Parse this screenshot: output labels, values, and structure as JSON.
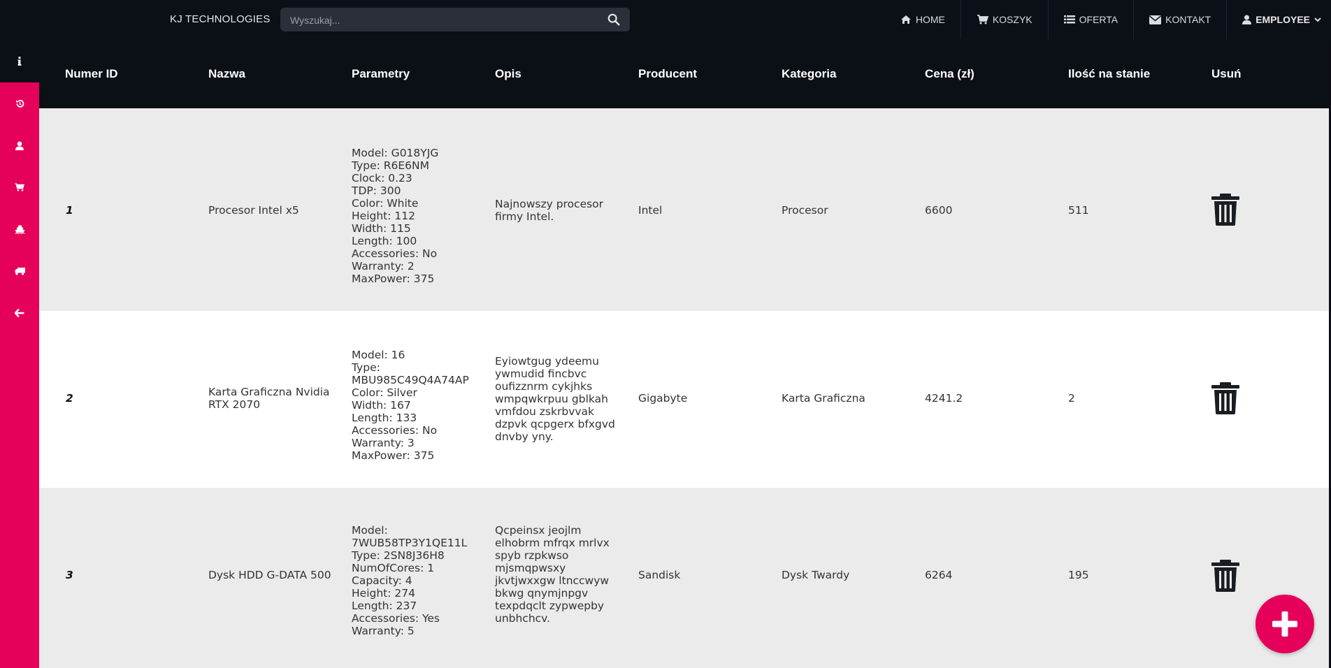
{
  "brand": "KJ TECHNOLOGIES",
  "search": {
    "placeholder": "Wyszukaj...",
    "value": ""
  },
  "nav": {
    "home": "HOME",
    "cart": "KOSZYK",
    "offer": "OFERTA",
    "contact": "KONTAKT",
    "user": "EMPLOYEE"
  },
  "sidebar": {
    "items": [
      "info-icon",
      "history-icon",
      "user-icon",
      "cart-icon",
      "ship-icon",
      "truck-icon",
      "back-arrow-icon"
    ]
  },
  "table": {
    "headers": [
      "Numer ID",
      "Nazwa",
      "Parametry",
      "Opis",
      "Producent",
      "Kategoria",
      "Cena (zł)",
      "Ilość na stanie",
      "Usuń"
    ],
    "rows": [
      {
        "id": "1",
        "name": [
          "Procesor Intel x5"
        ],
        "params": [
          "Model: G018YJG",
          "Type: R6E6NM",
          "Clock: 0.23",
          "TDP: 300",
          "Color: White",
          "Height: 112",
          "Width: 115",
          "Length: 100",
          "Accessories: No",
          "Warranty: 2",
          "MaxPower: 375"
        ],
        "desc": [
          "Najnowszy procesor",
          "firmy Intel."
        ],
        "producer": "Intel",
        "category": "Procesor",
        "price": "6600",
        "stock": "511"
      },
      {
        "id": "2",
        "name": [
          "Karta Graficzna Nvidia",
          "RTX 2070"
        ],
        "params": [
          "Model: 16",
          "Type:",
          "MBU985C49Q4A74AP",
          "Color: Silver",
          "Width: 167",
          "Length: 133",
          "Accessories: No",
          "Warranty: 3",
          "MaxPower: 375"
        ],
        "desc": [
          "Eyiowtgug ydeemu",
          "ywmudid fincbvc",
          "oufizznrm cykjhks",
          "wmpqwkrpuu gblkah",
          "vmfdou zskrbvvak",
          "dzpvk qcpgerx bfxgvd",
          "dnvby yny."
        ],
        "producer": "Gigabyte",
        "category": "Karta Graficzna",
        "price": "4241.2",
        "stock": "2"
      },
      {
        "id": "3",
        "name": [
          "Dysk HDD G-DATA 500"
        ],
        "params": [
          "Model:",
          "7WUB58TP3Y1QE11L",
          "Type: 2SN8J36H8",
          "NumOfCores: 1",
          "Capacity: 4",
          "Height: 274",
          "Length: 237",
          "Accessories: Yes",
          "Warranty: 5"
        ],
        "desc": [
          "Qcpeinsx jeojlm",
          "elhobrm mfrqx mrlvx",
          "spyb rzpkwso",
          "mjsmqpwsxy",
          "jkvtjwxxgw ltnccwyw",
          "bkwg qnymjnpgv",
          "texpdqclt zypwepby",
          "unbhchcv."
        ],
        "producer": "Sandisk",
        "category": "Dysk Twardy",
        "price": "6264",
        "stock": "195"
      }
    ]
  },
  "fab": {
    "icon": "plus-icon"
  },
  "colors": {
    "accent": "#e5005a",
    "dark": "#0b0f16",
    "row_alt": "#ebebeb"
  }
}
